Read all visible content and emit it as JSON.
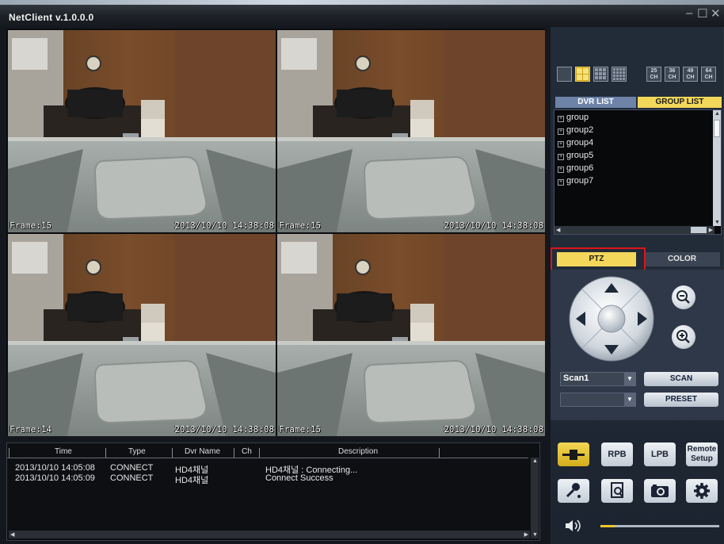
{
  "app": {
    "title": "NetClient  v.1.0.0.0",
    "window_buttons": {
      "minimize": "–",
      "maximize": "☐",
      "close": "✕"
    }
  },
  "video": {
    "tiles": [
      {
        "frame": "Frame:15",
        "timestamp": "2013/10/10 14:38:08"
      },
      {
        "frame": "Frame:15",
        "timestamp": "2013/10/10 14:38:08"
      },
      {
        "frame": "Frame:14",
        "timestamp": "2013/10/10 14:38:08"
      },
      {
        "frame": "Frame:15",
        "timestamp": "2013/10/10 14:38:08"
      }
    ]
  },
  "log": {
    "columns": [
      "Time",
      "Type",
      "Dvr Name",
      "Ch",
      "Description"
    ],
    "rows": [
      {
        "time": "2013/10/10 14:05:08",
        "type": "CONNECT",
        "dvr": "HD4채널",
        "ch": "",
        "desc": "HD4채널 : Connecting..."
      },
      {
        "time": "2013/10/10 14:05:09",
        "type": "CONNECT",
        "dvr": "HD4채널",
        "ch": "",
        "desc": "Connect Success"
      }
    ]
  },
  "layouts": {
    "labels": [
      "25",
      "36",
      "49",
      "64"
    ],
    "ch": "CH"
  },
  "tabs": {
    "dvr_list": "DVR LIST",
    "group_list": "GROUP LIST"
  },
  "groups": [
    "group",
    "group2",
    "group4",
    "group5",
    "group6",
    "group7"
  ],
  "tree_expand_symbol": "+",
  "ptz": {
    "tab_ptz": "PTZ",
    "tab_color": "COLOR",
    "scan_combo": "Scan1",
    "preset_combo": "",
    "scan_button": "SCAN",
    "preset_button": "PRESET",
    "zoom_out": "−",
    "zoom_in": "+"
  },
  "tools": {
    "rpb": "RPB",
    "lpb": "LPB",
    "remote_setup_line1": "Remote",
    "remote_setup_line2": "Setup"
  },
  "volume": {
    "level": 0.12
  },
  "colors": {
    "accent_yellow": "#f3d75a",
    "highlight_red": "#e0131b",
    "tab_blue": "#6d84a8"
  }
}
